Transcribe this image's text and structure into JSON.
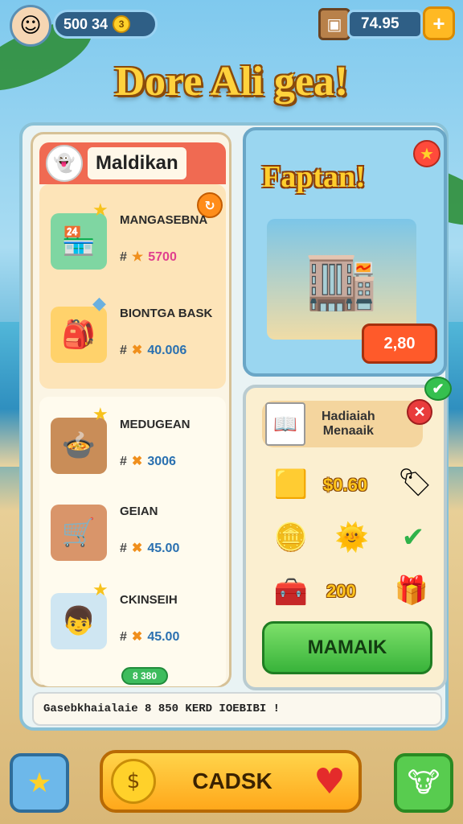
{
  "topbar": {
    "coins": "500 34",
    "coins_badge": "3",
    "coins_icon": "coin-icon",
    "gems": "74.95",
    "plus_label": "+"
  },
  "title": "Dore Ali gea!",
  "left_panel": {
    "header": "Maldikan",
    "items": [
      {
        "name": "MANGASEBNA",
        "price": "5700",
        "hash": "#",
        "icon": "shop-stall-icon"
      },
      {
        "name": "BIONTGA BASK",
        "price": "40.006",
        "hash": "#",
        "icon": "backpack-icon"
      },
      {
        "name": "MEDUGEAN",
        "price": "3006",
        "hash": "#",
        "icon": "cooking-pot-icon"
      },
      {
        "name": "GEIAN",
        "price": "45.00",
        "hash": "#",
        "icon": "cart-icon"
      },
      {
        "name": "CKINSEIH",
        "price": "45.00",
        "hash": "#",
        "icon": "boy-character-icon"
      }
    ],
    "green_badge": "8 380"
  },
  "featured": {
    "title": "Faptan!",
    "price": "2,80"
  },
  "rewards": {
    "header_line1": "Hadiaiah",
    "header_line2": "Menaaik",
    "row1_value": "$0.60",
    "row3_value": "200",
    "claim_label": "MAMAIK"
  },
  "ticker": "Gasebkhaialaie  8 850  KERD IOEBIBI !",
  "bottom": {
    "main_label": "CADSK"
  }
}
